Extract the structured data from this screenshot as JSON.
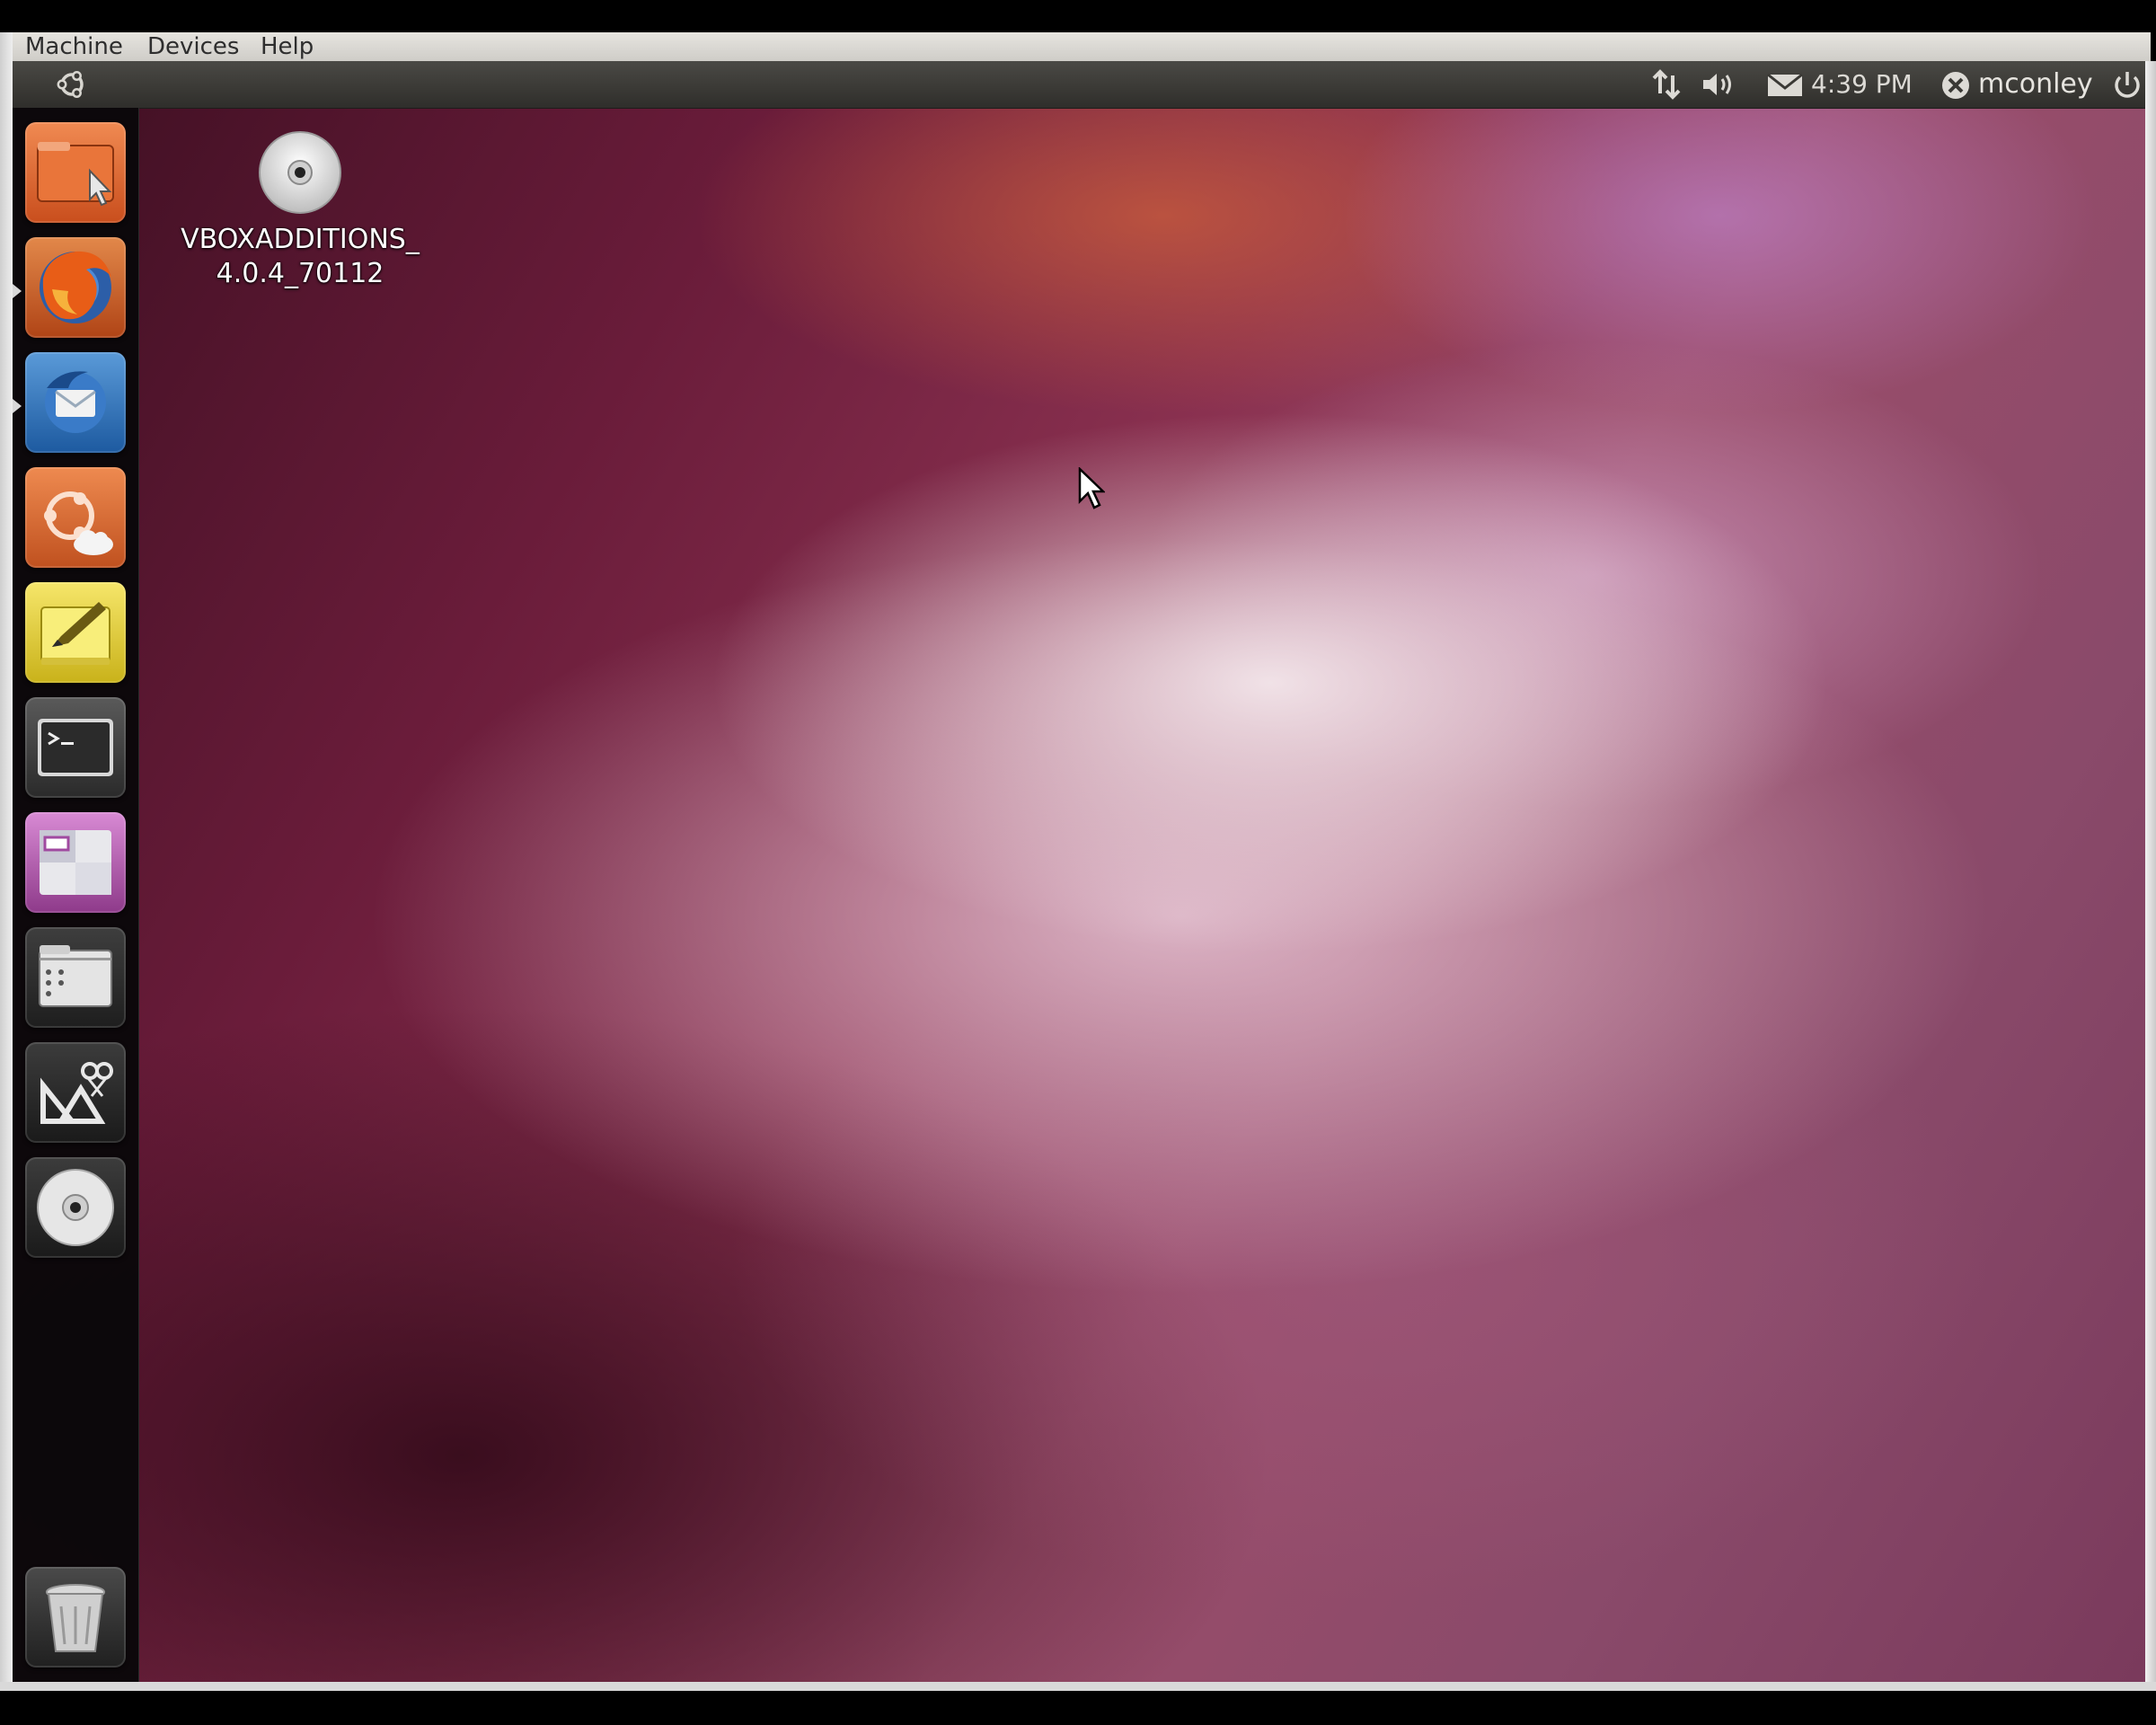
{
  "host_menu": {
    "items": [
      "Machine",
      "Devices",
      "Help"
    ]
  },
  "top_panel": {
    "clock": "4:39 PM",
    "username": "mconley"
  },
  "launcher": {
    "items": [
      {
        "name": "home-folder",
        "icon": "folder-icon",
        "running": false
      },
      {
        "name": "firefox",
        "icon": "firefox-icon",
        "running": true
      },
      {
        "name": "thunderbird",
        "icon": "thunderbird-icon",
        "running": true
      },
      {
        "name": "ubuntu-one",
        "icon": "ubuntu-one-icon",
        "running": false
      },
      {
        "name": "gedit",
        "icon": "text-editor-icon",
        "running": false
      },
      {
        "name": "terminal",
        "icon": "terminal-icon",
        "running": false
      },
      {
        "name": "workspace-switcher",
        "icon": "workspaces-icon",
        "running": false
      },
      {
        "name": "applications",
        "icon": "applications-icon",
        "running": false
      },
      {
        "name": "files-folders",
        "icon": "files-folders-icon",
        "running": false
      },
      {
        "name": "cd-drive",
        "icon": "disc-icon",
        "running": false
      },
      {
        "name": "trash",
        "icon": "trash-icon",
        "running": false
      }
    ]
  },
  "desktop": {
    "icons": [
      {
        "label_line1": "VBOXADDITIONS_",
        "label_line2": "4.0.4_70112",
        "icon": "disc-icon"
      }
    ]
  },
  "colors": {
    "panel": "#3a3935",
    "launcher": "#0a080a",
    "orange": "#e0662c",
    "aubergine": "#6a1c3a"
  }
}
